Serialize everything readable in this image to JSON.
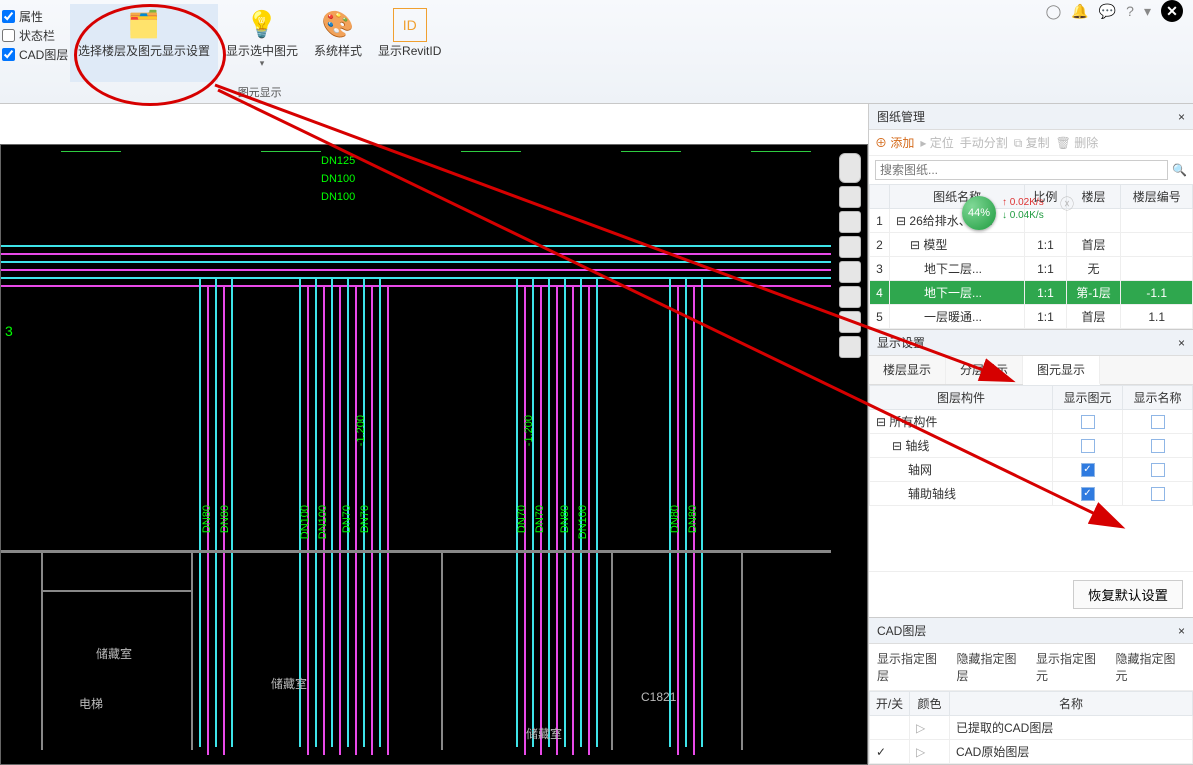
{
  "topicons": {
    "help": "?"
  },
  "leftchecks": {
    "c1": "属性",
    "c2": "状态栏",
    "c3": "CAD图层"
  },
  "ribbon": {
    "b1": "选择楼层及图元显示设置",
    "b2": "显示选中图元",
    "b3": "系统样式",
    "b4": "显示RevitID",
    "group": "图元显示"
  },
  "drawing_mgr": {
    "title": "图纸管理",
    "add": "添加",
    "loc": "定位",
    "split": "手动分割",
    "copy": "复制",
    "del": "删除",
    "search_placeholder": "搜索图纸...",
    "cols": {
      "c1": "图纸名称",
      "c2": "比例",
      "c3": "楼层",
      "c4": "楼层编号"
    },
    "rows": [
      {
        "idx": "1",
        "name": "26给排水、暖...",
        "ratio": "",
        "floor": "",
        "no": ""
      },
      {
        "idx": "2",
        "name": "模型",
        "ratio": "1:1",
        "floor": "首层",
        "no": ""
      },
      {
        "idx": "3",
        "name": "地下二层...",
        "ratio": "1:1",
        "floor": "无",
        "no": ""
      },
      {
        "idx": "4",
        "name": "地下一层...",
        "ratio": "1:1",
        "floor": "第-1层",
        "no": "-1.1"
      },
      {
        "idx": "5",
        "name": "一层暖通...",
        "ratio": "1:1",
        "floor": "首层",
        "no": "1.1"
      }
    ]
  },
  "display": {
    "title": "显示设置",
    "tabs": {
      "t1": "楼层显示",
      "t2": "分层显示",
      "t3": "图元显示"
    },
    "cols": {
      "c1": "图层构件",
      "c2": "显示图元",
      "c3": "显示名称"
    },
    "rows": [
      {
        "name": "所有构件",
        "show": false,
        "showname": false,
        "ind": 0,
        "tree": "-"
      },
      {
        "name": "轴线",
        "show": false,
        "showname": false,
        "ind": 1,
        "tree": "-"
      },
      {
        "name": "轴网",
        "show": true,
        "showname": false,
        "ind": 2,
        "tree": ""
      },
      {
        "name": "辅助轴线",
        "show": true,
        "showname": false,
        "ind": 2,
        "tree": ""
      }
    ],
    "restore": "恢复默认设置"
  },
  "cadlayer": {
    "title": "CAD图层",
    "actions": {
      "a1": "显示指定图层",
      "a2": "隐藏指定图层",
      "a3": "显示指定图元",
      "a4": "隐藏指定图元"
    },
    "cols": {
      "c1": "开/关",
      "c2": "颜色",
      "c3": "名称"
    },
    "rows": [
      {
        "on": false,
        "name": "已提取的CAD图层"
      },
      {
        "on": true,
        "name": "CAD原始图层"
      }
    ]
  },
  "badge": {
    "pct": "44%",
    "up": "0.02K/s",
    "dn": "0.04K/s"
  },
  "cad": {
    "dn": [
      "DN125",
      "DN100",
      "DN100"
    ],
    "elev": "-1.200",
    "pipesA": [
      "DN80",
      "DN80"
    ],
    "pipesB": [
      "DN100",
      "DN100",
      "DN70",
      "DN70"
    ],
    "pipesC": [
      "DN70",
      "DN70",
      "DN80",
      "DN100"
    ],
    "pipesD": [
      "DN80",
      "DN80"
    ],
    "rooms": {
      "r1": "储藏室",
      "r2": "储藏室",
      "r3": "电梯",
      "r4": "储藏室",
      "r5": "C1821"
    },
    "mark": "3"
  }
}
